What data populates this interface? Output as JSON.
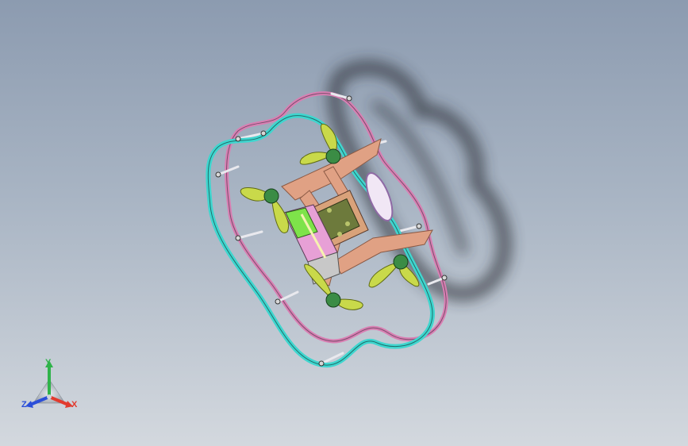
{
  "viewport": {
    "background_top": "#8c9bb0",
    "background_bottom": "#d3d8de"
  },
  "model": {
    "colors": {
      "cage_cyan": "#3fd6cf",
      "cage_pink": "#d97fb3",
      "frame": "#e0a184",
      "propeller": "#c9d94a",
      "motor": "#3b8c45",
      "battery_green": "#7ee34a",
      "battery_pink": "#e7a0d6",
      "electronics": "#6d7a3c",
      "shadow": "#2b2e35"
    }
  },
  "triad": {
    "labels": {
      "x": "X",
      "y": "Y",
      "z": "Z"
    },
    "colors": {
      "x": "#e23a2e",
      "y": "#2fb34a",
      "z": "#2b4fd9"
    }
  }
}
